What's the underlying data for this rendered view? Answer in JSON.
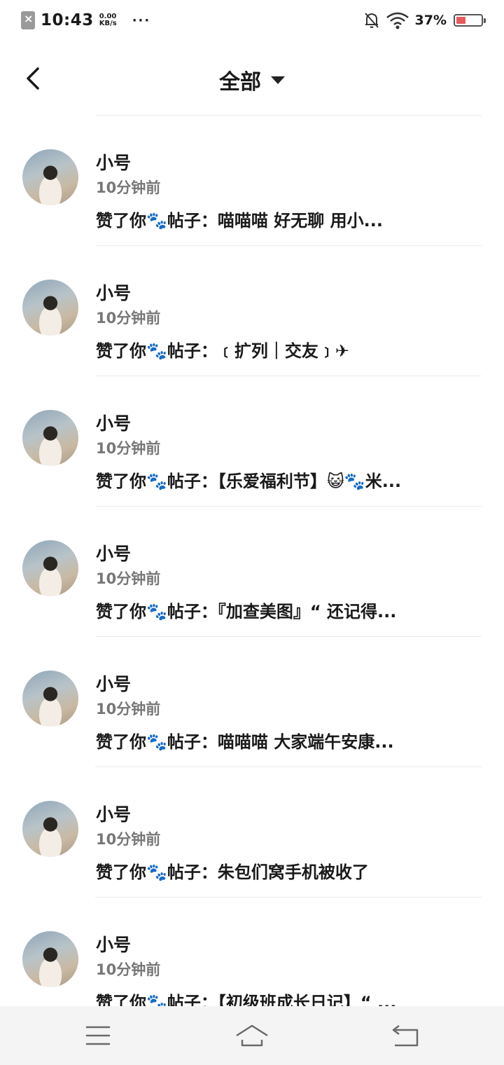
{
  "status_bar": {
    "time": "10:43",
    "speed_value": "0.00",
    "speed_unit": "KB/s",
    "more": "···",
    "battery_percent": "37%",
    "battery_level": 0.37,
    "icons": [
      "sim-off-icon",
      "bell-off-icon",
      "wifi-icon",
      "battery-icon"
    ]
  },
  "header": {
    "title": "全部",
    "back_icon": "chevron-left-icon",
    "dropdown_icon": "caret-down-icon"
  },
  "notifications": [
    {
      "name": "小号",
      "time": "10分钟前",
      "message": "赞了你🐾帖子：喵喵喵 好无聊 用小..."
    },
    {
      "name": "小号",
      "time": "10分钟前",
      "message": "赞了你🐾帖子：﹝扩列｜交友﹞✈"
    },
    {
      "name": "小号",
      "time": "10分钟前",
      "message": "赞了你🐾帖子：【乐爱福利节】😺🐾米..."
    },
    {
      "name": "小号",
      "time": "10分钟前",
      "message": "赞了你🐾帖子：『加查美图』“ 还记得..."
    },
    {
      "name": "小号",
      "time": "10分钟前",
      "message": "赞了你🐾帖子：喵喵喵 大家端午安康..."
    },
    {
      "name": "小号",
      "time": "10分钟前",
      "message": "赞了你🐾帖子：朱包们窝手机被收了"
    },
    {
      "name": "小号",
      "time": "10分钟前",
      "message": "赞了你🐾帖子：【初级班成长日记】“ ..."
    }
  ],
  "nav_bar": {
    "icons": [
      "menu-icon",
      "home-icon",
      "back-icon"
    ]
  }
}
